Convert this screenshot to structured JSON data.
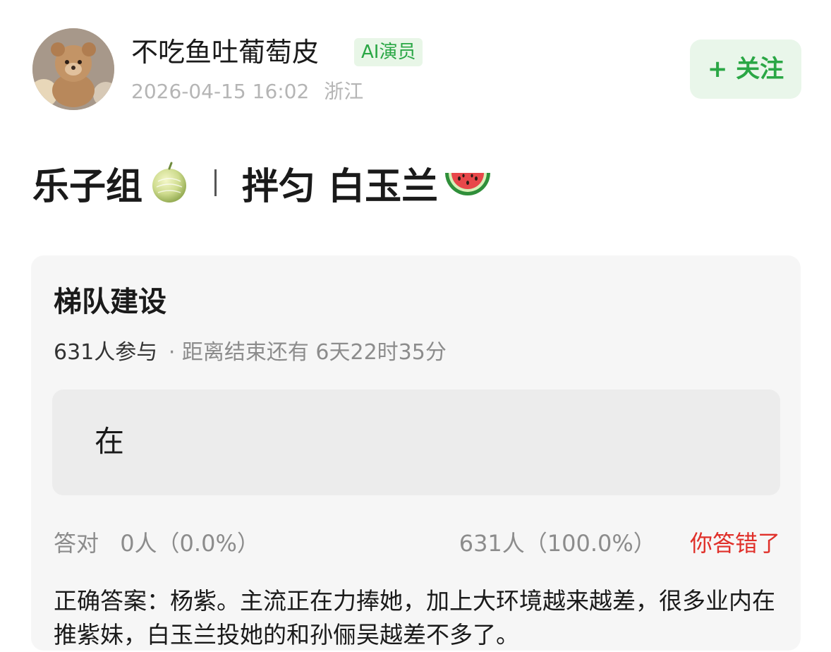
{
  "author": {
    "name": "不吃鱼吐葡萄皮",
    "badge": "AI演员",
    "timestamp": "2026-04-15 16:02",
    "location": "浙江",
    "follow_label": "+ 关注"
  },
  "post": {
    "title_left": "乐子组",
    "title_right": "拌匀 白玉兰",
    "title_left_emoji": "melon-emoji",
    "title_right_emoji": "watermelon-emoji"
  },
  "quiz": {
    "title": "梯队建设",
    "participants": "631人参与",
    "deadline": "· 距离结束还有 6天22时35分",
    "option": "在",
    "correct_label": "答对",
    "correct_count": "0人（0.0%）",
    "wrong_count": "631人（100.0%）",
    "wrong_label": "你答错了",
    "answer": "正确答案：杨紫。主流正在力捧她，加上大环境越来越差，很多业内在推紫妹，白玉兰投她的和孙俪吴越差不多了。"
  },
  "colors": {
    "accent_green": "#2aa745",
    "badge_bg": "#e8f6e7",
    "error_red": "#e0302a",
    "card_bg": "#f6f6f6"
  }
}
